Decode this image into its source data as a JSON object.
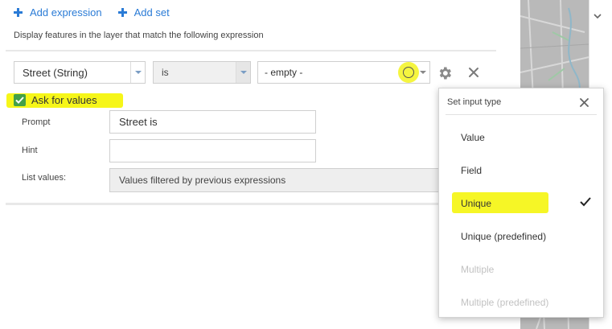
{
  "toolbar": {
    "add_expression_label": "Add expression",
    "add_set_label": "Add set"
  },
  "instruction": "Display features in the layer that match the following expression",
  "expression": {
    "field_value": "Street (String)",
    "operator_value": "is",
    "value_placeholder": "- empty -"
  },
  "ask_for_values": {
    "label": "Ask for values",
    "checked": true
  },
  "form": {
    "prompt_label": "Prompt",
    "prompt_value": "Street is",
    "hint_label": "Hint",
    "hint_value": "",
    "list_values_label": "List values:",
    "list_values_value": "Values filtered by previous expressions"
  },
  "popover": {
    "title": "Set input type",
    "options": [
      {
        "label": "Value",
        "enabled": true,
        "selected": false
      },
      {
        "label": "Field",
        "enabled": true,
        "selected": false
      },
      {
        "label": "Unique",
        "enabled": true,
        "selected": true
      },
      {
        "label": "Unique (predefined)",
        "enabled": true,
        "selected": false
      },
      {
        "label": "Multiple",
        "enabled": false,
        "selected": false
      },
      {
        "label": "Multiple (predefined)",
        "enabled": false,
        "selected": false
      }
    ]
  },
  "colors": {
    "accent": "#2a7bd6",
    "checkbox": "#43a047",
    "highlight": "#f5f500",
    "disabled_text": "#c2c2c2"
  },
  "icons": {
    "add": "plus-icon",
    "settings": "gear-icon",
    "remove": "close-icon",
    "input_type": "circle-icon",
    "selected": "checkmark-icon"
  }
}
